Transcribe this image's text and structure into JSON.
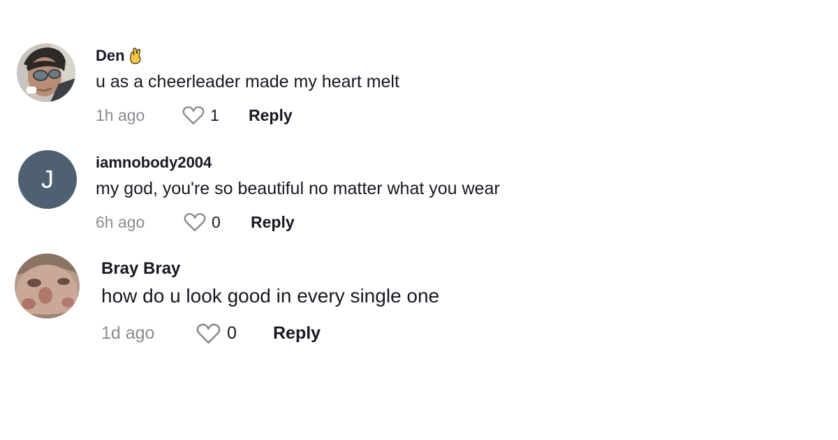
{
  "comments": [
    {
      "username": "Den",
      "username_icon": "hand-gesture-emoji-icon",
      "text": "u as a cheerleader made my heart melt",
      "time": "1h ago",
      "likes": "1",
      "reply_label": "Reply",
      "avatar_type": "photo"
    },
    {
      "username": "iamnobody2004",
      "text": "my god, you're so beautiful no matter what you wear",
      "time": "6h ago",
      "likes": "0",
      "reply_label": "Reply",
      "avatar_type": "letter",
      "avatar_letter": "J",
      "avatar_color": "#4f6170"
    },
    {
      "username": "Bray Bray",
      "text": "how do u look good in every single one",
      "time": "1d ago",
      "likes": "0",
      "reply_label": "Reply",
      "avatar_type": "photo"
    }
  ],
  "colors": {
    "text": "#161823",
    "muted": "#8a8b91",
    "heart_outline": "#8a8b91"
  }
}
